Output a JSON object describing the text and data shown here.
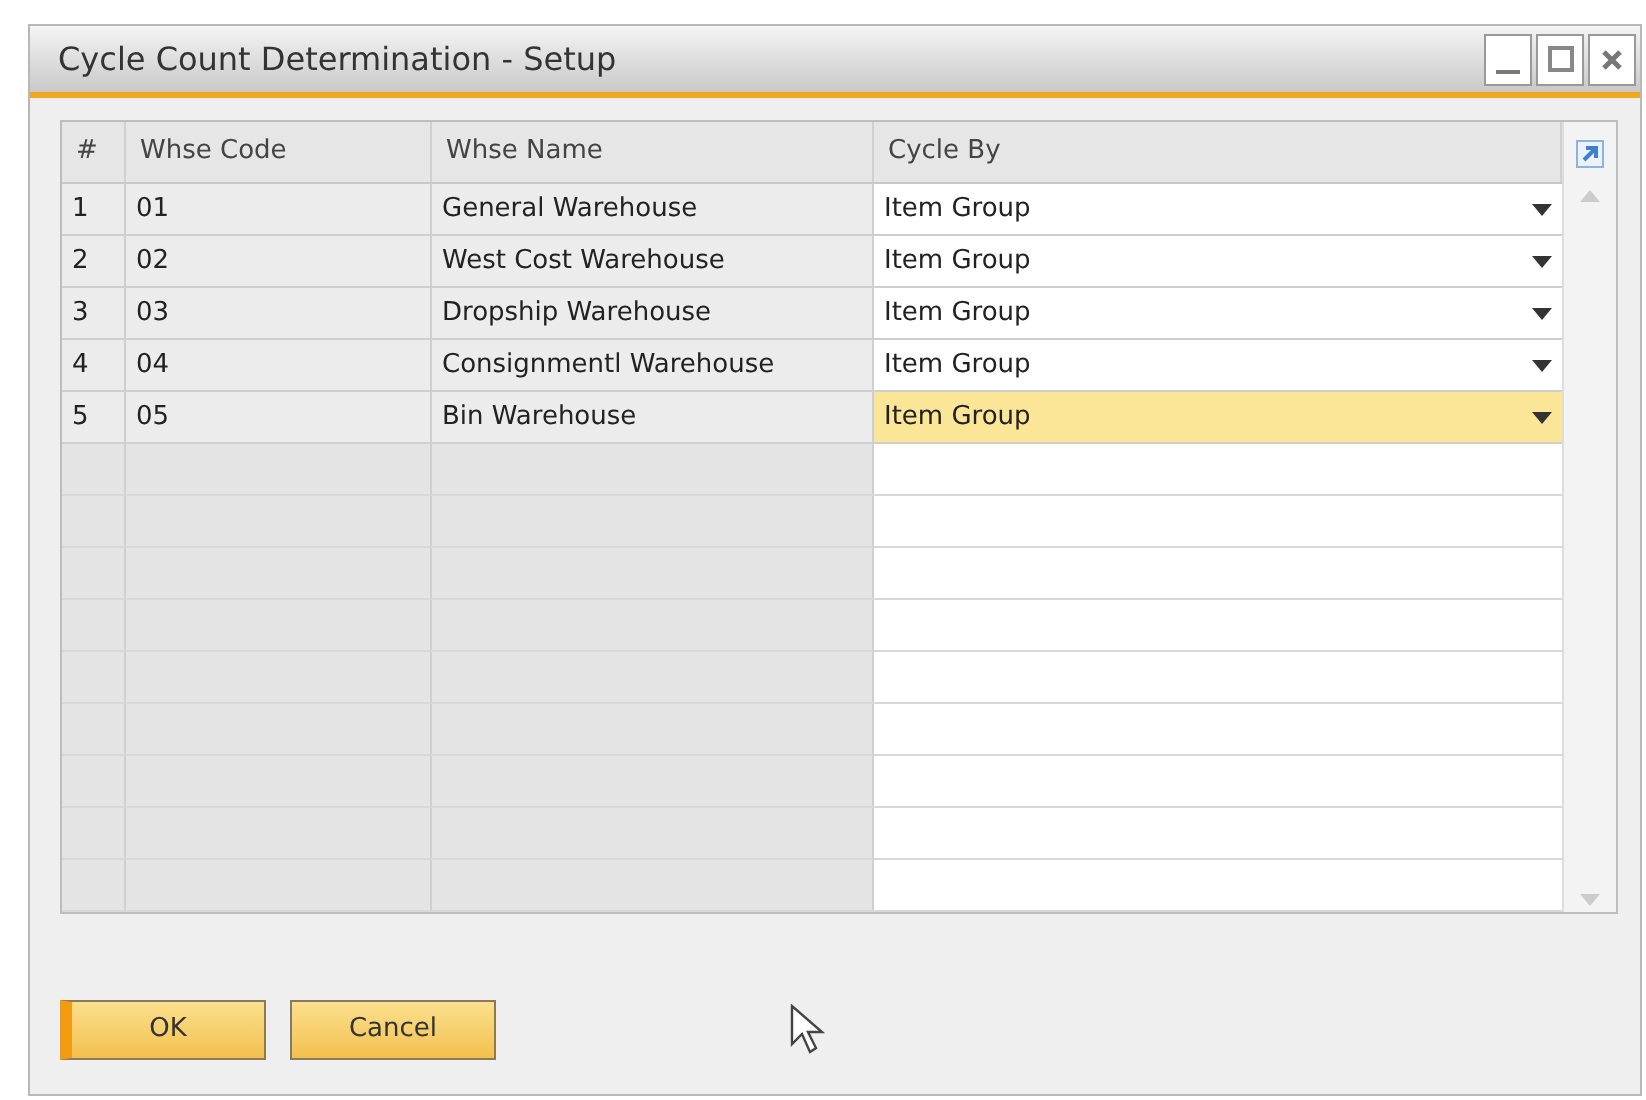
{
  "window": {
    "title": "Cycle Count Determination - Setup"
  },
  "table": {
    "columns": [
      "#",
      "Whse Code",
      "Whse Name",
      "Cycle By"
    ],
    "rows": [
      {
        "cells": [
          "1",
          "01",
          "General Warehouse",
          "Item Group"
        ],
        "selected": false
      },
      {
        "cells": [
          "2",
          "02",
          "West Cost Warehouse",
          "Item Group"
        ],
        "selected": false
      },
      {
        "cells": [
          "3",
          "03",
          "Dropship Warehouse",
          "Item Group"
        ],
        "selected": false
      },
      {
        "cells": [
          "4",
          "04",
          "Consignmentl Warehouse",
          "Item Group"
        ],
        "selected": false
      },
      {
        "cells": [
          "5",
          "05",
          "Bin Warehouse",
          "Item Group"
        ],
        "selected": true
      }
    ]
  },
  "buttons": [
    "OK",
    "Cancel"
  ]
}
